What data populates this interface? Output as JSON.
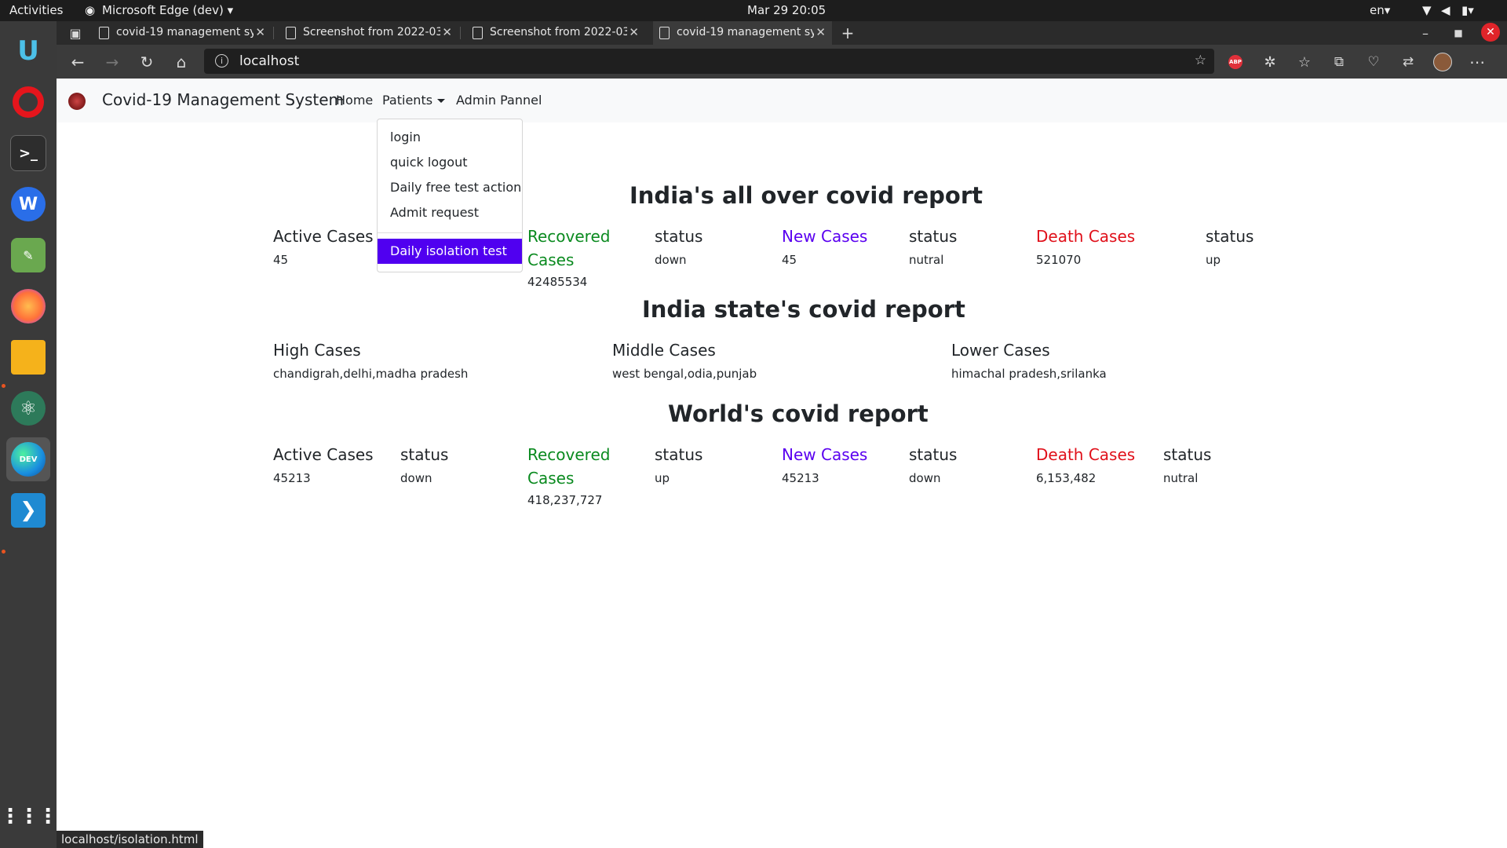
{
  "system": {
    "activities": "Activities",
    "app_menu": "Microsoft Edge (dev)",
    "clock": "Mar 29  20:05",
    "lang": "en"
  },
  "browser": {
    "tabs": [
      {
        "label": "covid-19 management sy",
        "active": false
      },
      {
        "label": "Screenshot from 2022-03",
        "active": false
      },
      {
        "label": "Screenshot from 2022-03",
        "active": false
      },
      {
        "label": "covid-19 management sy",
        "active": true
      }
    ],
    "url": "localhost",
    "status_url": "localhost/isolation.html",
    "abp_label": "ABP"
  },
  "navbar": {
    "brand": "Covid-19 Management System",
    "home": "Home",
    "patients": "Patients",
    "admin": "Admin Pannel"
  },
  "dropdown": {
    "items": [
      "login",
      "quick logout",
      "Daily free test action",
      "Admit request"
    ],
    "active_item": "Daily isolation test"
  },
  "india": {
    "title": "India's all over covid report",
    "active_label": "Active Cases",
    "active_value": "45",
    "recovered_label_1": "Recovered",
    "recovered_label_2": "Cases",
    "recovered_value": "42485534",
    "status1_label": "status",
    "status1_value": "down",
    "new_label": "New Cases",
    "new_value": "45",
    "status2_label": "status",
    "status2_value": "nutral",
    "death_label": "Death Cases",
    "death_value": "521070",
    "status3_label": "status",
    "status3_value": "up"
  },
  "states": {
    "title": "India state's covid report",
    "high_label": "High Cases",
    "high_value": "chandigrah,delhi,madha pradesh",
    "middle_label": "Middle Cases",
    "middle_value": "west bengal,odia,punjab",
    "lower_label": "Lower Cases",
    "lower_value": "himachal pradesh,srilanka"
  },
  "world": {
    "title": "World's covid report",
    "active_label": "Active Cases",
    "active_value": "45213",
    "status0_label": "status",
    "status0_value": "down",
    "recovered_label_1": "Recovered",
    "recovered_label_2": "Cases",
    "recovered_value": "418,237,727",
    "status1_label": "status",
    "status1_value": "up",
    "new_label": "New Cases",
    "new_value": "45213",
    "status2_label": "status",
    "status2_value": "down",
    "death_label": "Death Cases",
    "death_value": "6,153,482",
    "status3_label": "status",
    "status3_value": "nutral"
  },
  "colors": {
    "recovered": "#0a8a1f",
    "new": "#5a00f0",
    "death": "#e0101a",
    "dropdown_active": "#5000f0"
  }
}
